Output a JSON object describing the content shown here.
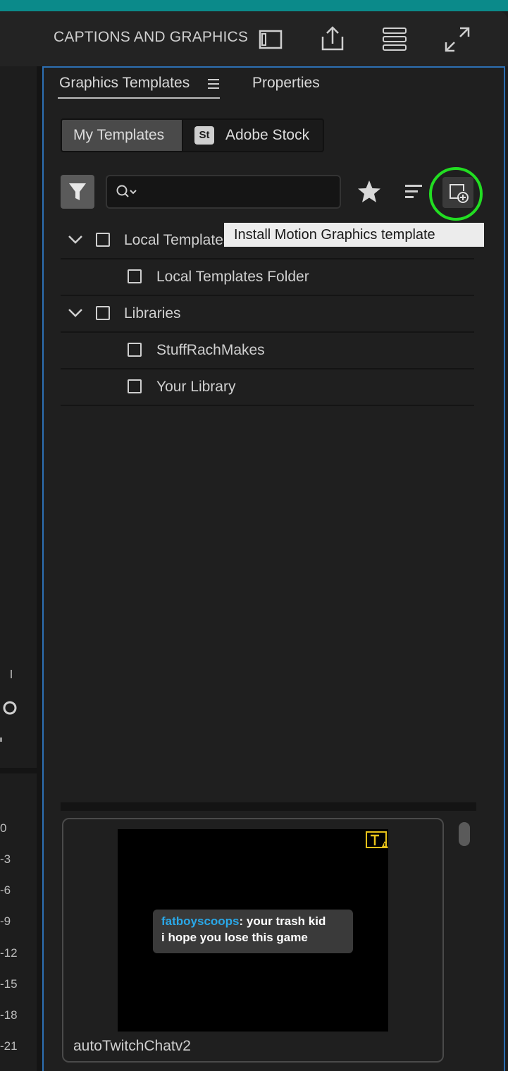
{
  "workspace": {
    "title": "CAPTIONS AND GRAPHICS"
  },
  "tabs": [
    {
      "label": "Graphics Templates",
      "active": true
    },
    {
      "label": "Properties",
      "active": false
    }
  ],
  "source_toggle": {
    "my_templates": "My Templates",
    "adobe_stock": "Adobe Stock",
    "stock_badge": "St"
  },
  "search": {
    "value": "",
    "placeholder": ""
  },
  "tooltip": {
    "text": "Install Motion Graphics template"
  },
  "tree": {
    "local_templates": "Local Templates",
    "local_templates_folder": "Local Templates Folder",
    "libraries": "Libraries",
    "stuffrachmakes": "StuffRachMakes",
    "your_library": "Your Library"
  },
  "left_meter_ticks": [
    "0",
    "-3",
    "-6",
    "-9",
    "-12",
    "-15",
    "-18",
    "-21"
  ],
  "template_card": {
    "name": "autoTwitchChatv2",
    "chat_user": "fatboyscoops",
    "chat_line1_rest": ": your trash kid",
    "chat_line2": "i hope you lose this game"
  },
  "colors": {
    "panel_focus_border": "#2d6fb3",
    "highlight_ring": "#22dd22",
    "chat_username": "#2aa8e8",
    "warning_badge": "#e8c21a"
  },
  "icons": [
    "panel-icon",
    "export-icon",
    "menu-icon",
    "expand-icon",
    "hamburger-icon",
    "filter-icon",
    "search-icon",
    "star-icon",
    "sort-icon",
    "new-template-icon",
    "chevron-down-icon",
    "font-warning-icon"
  ]
}
